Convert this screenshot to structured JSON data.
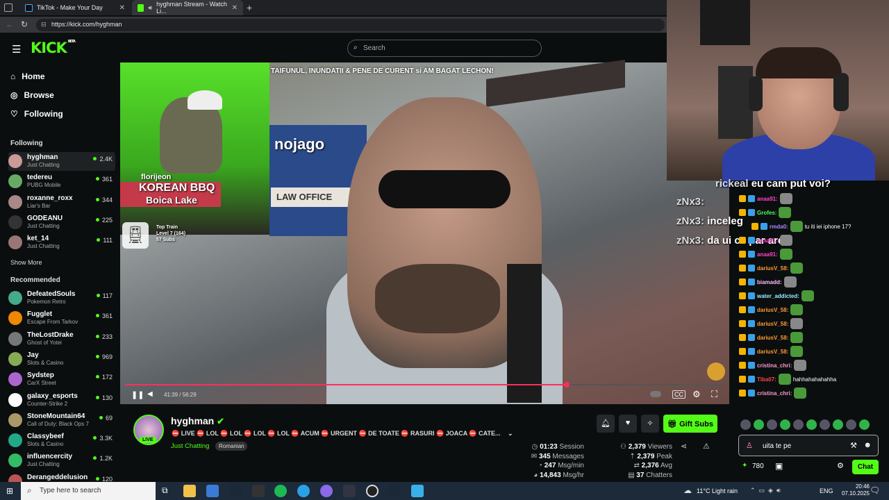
{
  "browser": {
    "tabs": [
      {
        "title": "TikTok - Make Your Day",
        "color": "#111"
      },
      {
        "title": "hyghman Stream - Watch Li...",
        "color": "#53fc18"
      }
    ],
    "url": "https://kick.com/hyghman"
  },
  "kick": {
    "logo": "KICK",
    "logo_badge": "BETA",
    "search_placeholder": "Search",
    "nav": [
      {
        "label": "Home",
        "icon": "home-icon",
        "glyph": "⌂"
      },
      {
        "label": "Browse",
        "icon": "compass-icon",
        "glyph": "◎"
      },
      {
        "label": "Following",
        "icon": "heart-icon",
        "glyph": "♡"
      }
    ],
    "following_title": "Following",
    "following": [
      {
        "name": "hyghman",
        "category": "Just Chatting",
        "viewers": "2.4K",
        "color": "#c99"
      },
      {
        "name": "tedereu",
        "category": "PUBG Mobile",
        "viewers": "361",
        "color": "#6a6"
      },
      {
        "name": "roxanne_roxx",
        "category": "Liar's Bar",
        "viewers": "344",
        "color": "#a88"
      },
      {
        "name": "GODEANU",
        "category": "Just Chatting",
        "viewers": "225",
        "color": "#333"
      },
      {
        "name": "ket_14",
        "category": "Just Chatting",
        "viewers": "111",
        "color": "#977"
      }
    ],
    "show_more": "Show More",
    "recommended_title": "Recommended",
    "recommended": [
      {
        "name": "DefeatedSouls",
        "category": "Pokemon Retro",
        "viewers": "117",
        "color": "#4a8"
      },
      {
        "name": "Fugglet",
        "category": "Escape From Tarkov",
        "viewers": "361",
        "color": "#e80"
      },
      {
        "name": "TheLostDrake",
        "category": "Ghost of Yotei",
        "viewers": "233",
        "color": "#777"
      },
      {
        "name": "Jay",
        "category": "Slots & Casino",
        "viewers": "969",
        "color": "#8a5"
      },
      {
        "name": "Sydstep",
        "category": "CarX Street",
        "viewers": "172",
        "color": "#a6c"
      },
      {
        "name": "galaxy_esports",
        "category": "Counter-Strike 2",
        "viewers": "130",
        "color": "#fff"
      },
      {
        "name": "StoneMountain64",
        "category": "Call of Duty: Black Ops 7",
        "viewers": "69",
        "color": "#a96"
      },
      {
        "name": "Classybeef",
        "category": "Slots & Casino",
        "viewers": "3.3K",
        "color": "#2a8"
      },
      {
        "name": "influencercity",
        "category": "Just Chatting",
        "viewers": "1.2K",
        "color": "#3b6"
      },
      {
        "name": "Derangeddelusion",
        "category": "",
        "viewers": "120",
        "color": "#b55"
      }
    ]
  },
  "video": {
    "title": "TAIFUNUL, INUNDATII & PENE DE CURENT si AM BAGAT LECHON!",
    "overlay_user": "florijeon",
    "overlay_sign": "KOREAN BBQ",
    "overlay_sign2": "Boica Lake",
    "overlay_store": "nojago",
    "overlay_law": "LAW OFFICE",
    "train_level": "Level 7 (164)",
    "train_title": "Top Train",
    "train_subs": "57 Subs",
    "time": "41:39 / 56:29",
    "progress": 0.74
  },
  "stream": {
    "name": "hyghman",
    "live": "LIVE",
    "title": "⛔ LIVE ⛔ LOL ⛔ LOL ⛔ LOL ⛔ LOL ⛔ ACUM ⛔ URGENT ⛔ DE TOATE ⛔ RASURI ⛔ JOACA ⛔ CATE...",
    "category": "Just Chatting",
    "language": "Romanian",
    "gift_label": "Gift Subs",
    "session": "01:23",
    "session_label": "Session",
    "messages": "345",
    "messages_label": "Messages",
    "msgmin": "247",
    "msgmin_label": "Msg/min",
    "msghr": "14,843",
    "msghr_label": "Msg/hr",
    "viewers": "2,379",
    "viewers_label": "Viewers",
    "peak": "2,379",
    "peak_label": "Peak",
    "avg": "2,376",
    "avg_label": "Avg",
    "chatters": "37",
    "chatters_label": "Chatters"
  },
  "chat": {
    "big_lines": [
      {
        "user": "rickeal",
        "text": "eu cam put voi?"
      },
      {
        "user": "zNx3:",
        "text": ""
      },
      {
        "user": "zNx3:",
        "text": "inceleg"
      },
      {
        "user": "zNx3:",
        "text": "da ui ce par are"
      }
    ],
    "messages": [
      {
        "user": "anaa91:",
        "color": "#f4c",
        "text": ""
      },
      {
        "user": "Grofes:",
        "color": "#5f5",
        "text": ""
      },
      {
        "user": "rmda0:",
        "color": "#a8f",
        "text": "tu iti iei iphone 17?"
      },
      {
        "user": "anaa91:",
        "color": "#f4c",
        "text": ""
      },
      {
        "user": "anaa91:",
        "color": "#f4c",
        "text": ""
      },
      {
        "user": "dariusV_58:",
        "color": "#f93",
        "text": ""
      },
      {
        "user": "biamadd:",
        "color": "#fbf",
        "text": ""
      },
      {
        "user": "water_addicted:",
        "color": "#9ef",
        "text": ""
      },
      {
        "user": "dariusV_58:",
        "color": "#f93",
        "text": ""
      },
      {
        "user": "dariusV_58:",
        "color": "#f93",
        "text": ""
      },
      {
        "user": "dariusV_58:",
        "color": "#f93",
        "text": ""
      },
      {
        "user": "dariusV_58:",
        "color": "#f93",
        "text": ""
      },
      {
        "user": "cristina_chri:",
        "color": "#f9c",
        "text": ""
      },
      {
        "user": "Tiba07:",
        "color": "#f44",
        "text": "hahhahahahahha"
      },
      {
        "user": "cristina_chri:",
        "color": "#f9c",
        "text": ""
      }
    ],
    "input_value": "uita te pe",
    "points": "780",
    "send_label": "Chat"
  },
  "taskbar": {
    "search_placeholder": "Type here to search",
    "weather": "11°C  Light rain",
    "lang": "ENG",
    "time": "20:46",
    "date": "07.10.2025"
  }
}
